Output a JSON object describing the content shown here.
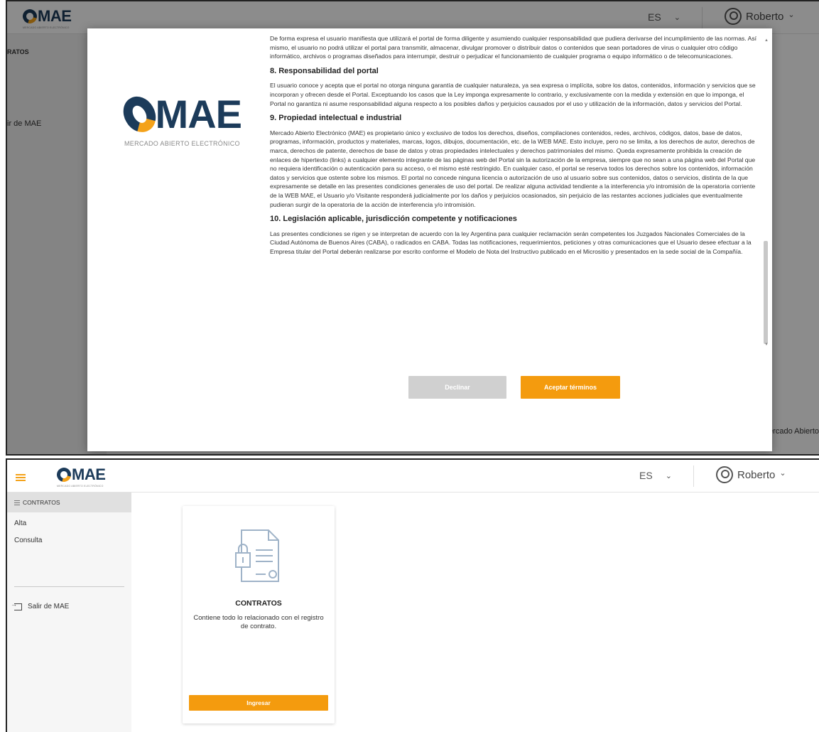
{
  "top": {
    "header": {
      "lang": "ES",
      "user": "Roberto"
    },
    "sidebar": {
      "section": "RATOS",
      "exit_label": "ir de MAE"
    },
    "footer_text": "ercado Abierto",
    "modal": {
      "intro_paragraph": "De forma expresa el usuario manifiesta que utilizará el portal de forma diligente y asumiendo cualquier responsabilidad que pudiera derivarse del incumplimiento de las normas. Así mismo, el usuario no podrá utilizar el portal para transmitir, almacenar, divulgar promover o distribuir datos o contenidos que sean portadores de virus o cualquier otro código informático, archivos o programas diseñados para interrumpir, destruir o perjudicar el funcionamiento de cualquier programa o equipo informático o de telecomunicaciones.",
      "sections": [
        {
          "heading": "8. Responsabilidad del portal",
          "body": "El usuario conoce y acepta que el portal no otorga ninguna garantía de cualquier naturaleza, ya sea expresa o implícita, sobre los datos, contenidos, información y servicios que se incorporan y ofrecen desde el Portal. Exceptuando los casos que la Ley imponga expresamente lo contrario, y exclusivamente con la medida y extensión en que lo imponga, el Portal no garantiza ni asume responsabilidad alguna respecto a los posibles daños y perjuicios causados por el uso y utilización de la información, datos y servicios del Portal."
        },
        {
          "heading": "9. Propiedad intelectual e industrial",
          "body": "Mercado Abierto Electrónico (MAE) es propietario único y exclusivo de todos los derechos, diseños, compilaciones contenidos, redes, archivos, códigos, datos, base de datos, programas, información, productos y materiales, marcas, logos, dibujos, documentación, etc. de la WEB MAE. Esto incluye, pero no se limita, a los derechos de autor, derechos de marca, derechos de patente, derechos de base de datos y otras propiedades intelectuales y derechos patrimoniales del mismo. Queda expresamente prohibida la creación de enlaces de hipertexto (links) a cualquier elemento integrante de las páginas web del Portal sin la autorización de la empresa, siempre que no sean a una página web del Portal que no requiera identificación o autenticación para su acceso, o el mismo esté restringido. En cualquier caso, el portal se reserva todos los derechos sobre los contenidos, información datos y servicios que ostente sobre los mismos. El portal no concede ninguna licencia o autorización de uso al usuario sobre sus contenidos, datos o servicios, distinta de la que expresamente se detalle en las presentes condiciones generales de uso del portal. De realizar alguna actividad tendiente a la interferencia y/o intromisión de la operatoria corriente de la WEB MAE, el Usuario y/o Visitante responderá judicialmente por los daños y perjuicios ocasionados, sin perjuicio de las restantes acciones judiciales que eventualmente pudieran surgir de la operatoria de la acción de interferencia y/o intromisión."
        },
        {
          "heading": "10. Legislación aplicable, jurisdicción competente y notificaciones",
          "body": "Las presentes condiciones se rigen y se interpretan de acuerdo con la ley Argentina para cualquier reclamación serán competentes los Juzgados Nacionales Comerciales de la Ciudad Autónoma de Buenos Aires (CABA), o radicados en CABA. Todas las notificaciones, requerimientos, peticiones y otras comunicaciones que el Usuario desee efectuar a la Empresa titular del Portal deberán realizarse por escrito conforme el Modelo de Nota del Instructivo publicado en el Micrositio y presentados en la sede social de la Compañía."
        }
      ],
      "decline_label": "Declinar",
      "accept_label": "Aceptar términos"
    }
  },
  "logo": {
    "word": "MAE",
    "subtitle": "MERCADO ABIERTO ELECTRÓNICO"
  },
  "bottom": {
    "header": {
      "lang": "ES",
      "user": "Roberto"
    },
    "sidebar": {
      "section": "CONTRATOS",
      "items": [
        "Alta",
        "Consulta"
      ],
      "exit_label": "Salir de MAE"
    },
    "card": {
      "title": "CONTRATOS",
      "description": "Contiene todo lo relacionado con el registro de contrato.",
      "button_label": "Ingresar"
    }
  },
  "colors": {
    "brand_navy": "#1c3b5a",
    "brand_orange": "#f49b0e",
    "disabled_gray": "#d0d0d0"
  },
  "icons": [
    "user-icon",
    "chevron-down-icon",
    "hamburger-icon",
    "menu-icon",
    "exit-icon",
    "contract-document-icon"
  ]
}
